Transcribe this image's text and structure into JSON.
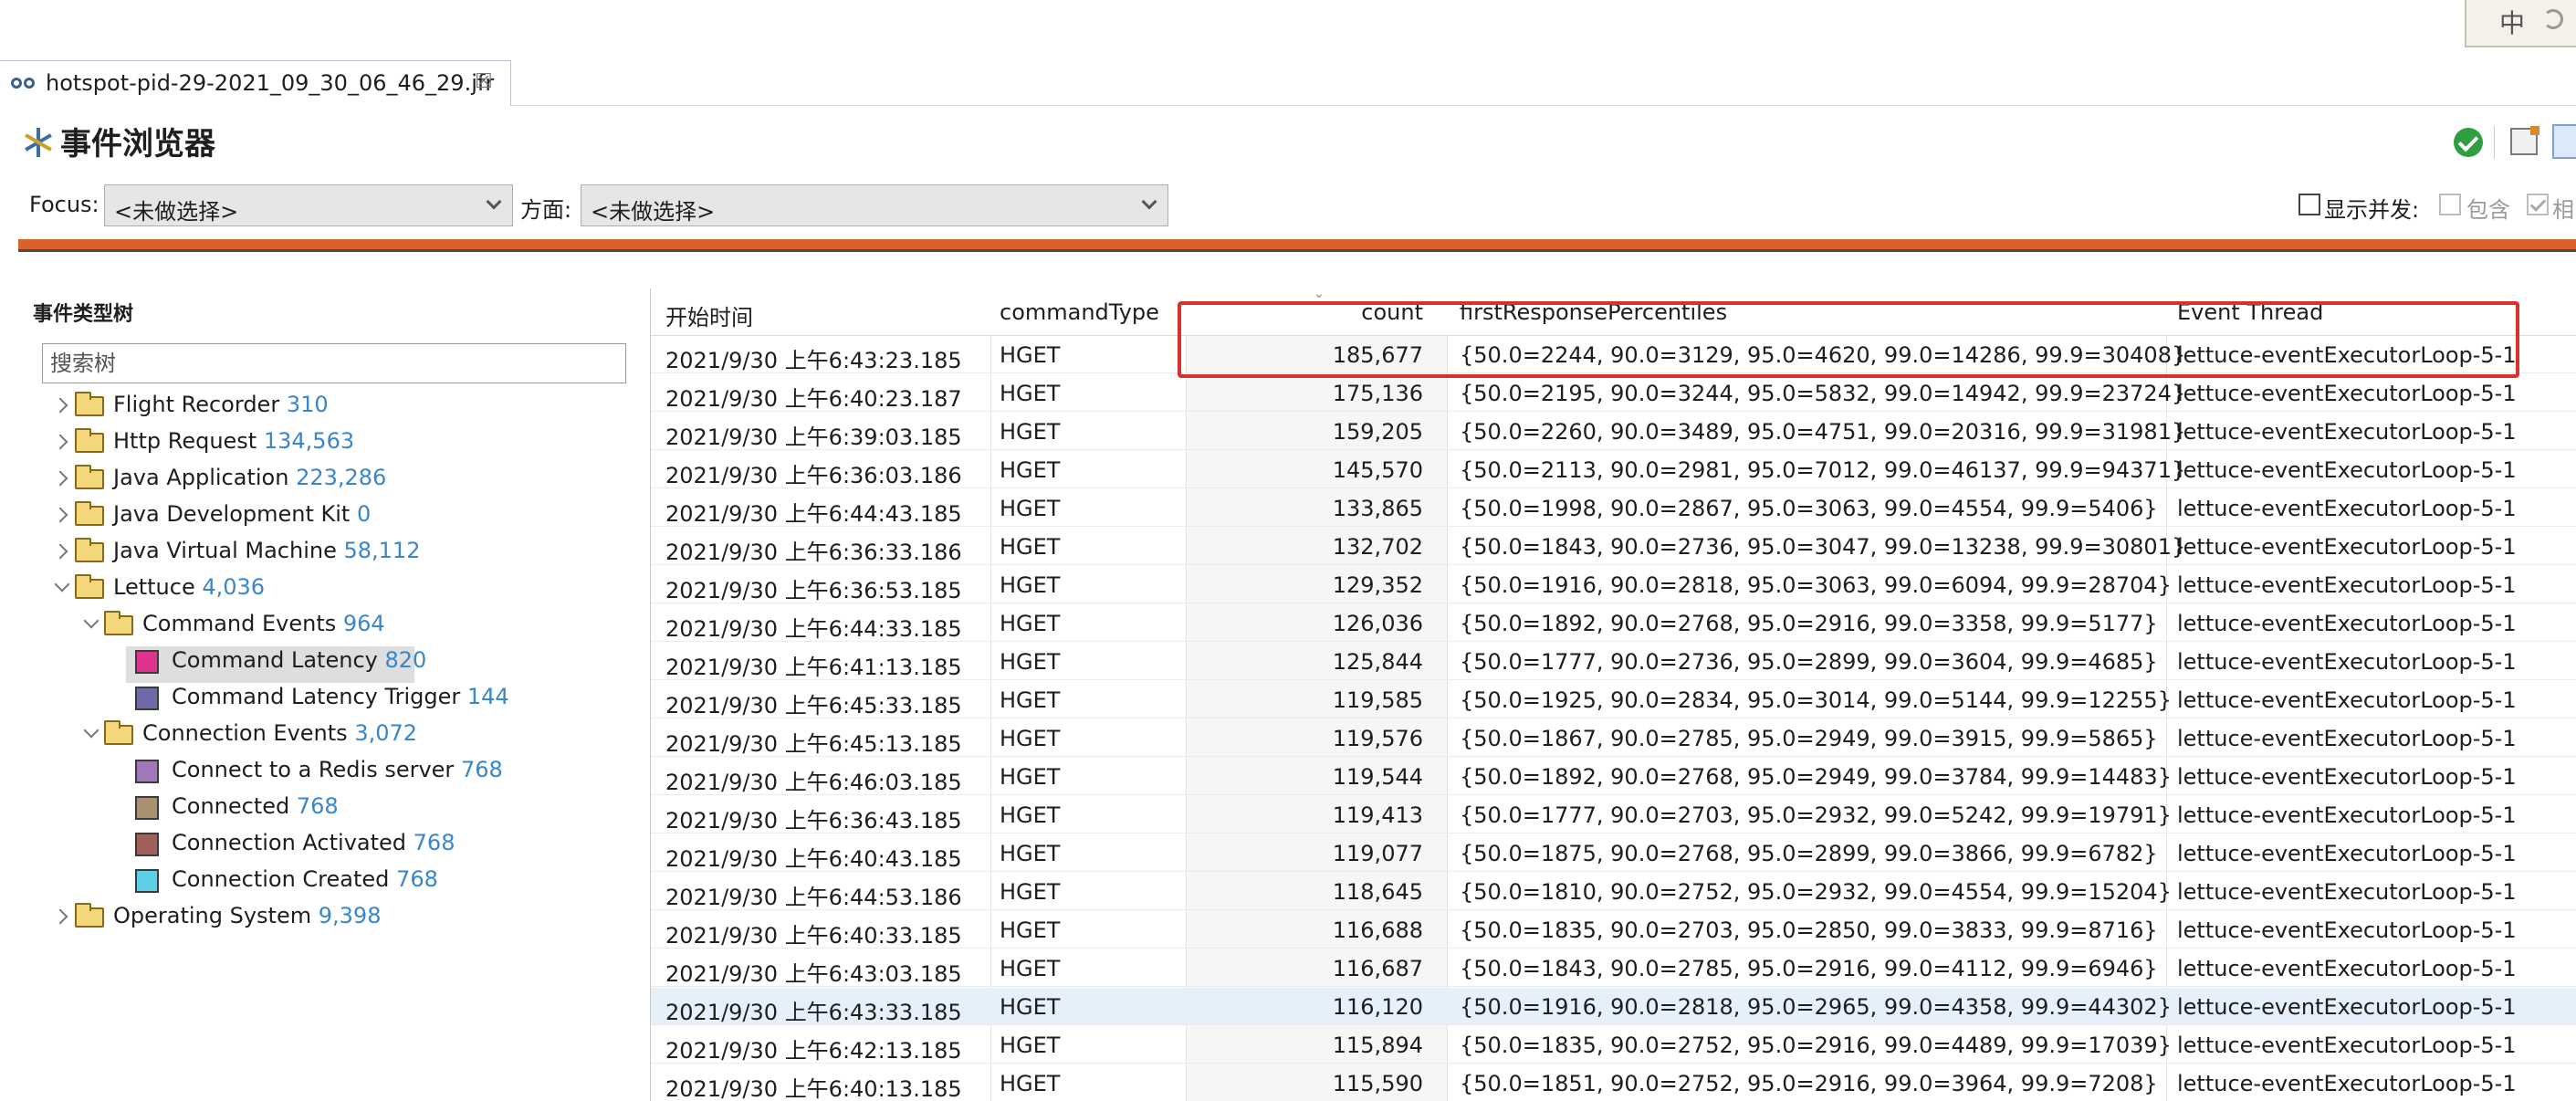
{
  "ime": {
    "char": "中"
  },
  "tab": {
    "title": "hotspot-pid-29-2021_09_30_06_46_29.jfr",
    "close_glyph": "☒"
  },
  "page": {
    "title": "事件浏览器"
  },
  "filter": {
    "focus_label": "Focus:",
    "focus_value": "<未做选择>",
    "aspect_label": "方面:",
    "aspect_value": "<未做选择>",
    "show_concurrent_label": "显示并发:",
    "include_label": "包含",
    "same_label": "相"
  },
  "tree": {
    "header": "事件类型树",
    "search_placeholder": "搜索树",
    "nodes": [
      {
        "label": "Flight Recorder",
        "count": "310"
      },
      {
        "label": "Http Request",
        "count": "134,563"
      },
      {
        "label": "Java Application",
        "count": "223,286"
      },
      {
        "label": "Java Development Kit",
        "count": "0"
      },
      {
        "label": "Java Virtual Machine",
        "count": "58,112"
      },
      {
        "label": "Lettuce",
        "count": "4,036"
      },
      {
        "label": "Command Events",
        "count": "964"
      },
      {
        "label": "Command Latency",
        "count": "820",
        "color": "#e0338f"
      },
      {
        "label": "Command Latency Trigger",
        "count": "144",
        "color": "#6f6aa8"
      },
      {
        "label": "Connection Events",
        "count": "3,072"
      },
      {
        "label": "Connect to a Redis server",
        "count": "768",
        "color": "#a077b8"
      },
      {
        "label": "Connected",
        "count": "768",
        "color": "#a89070"
      },
      {
        "label": "Connection Activated",
        "count": "768",
        "color": "#a0615a"
      },
      {
        "label": "Connection Created",
        "count": "768",
        "color": "#5dd0e6"
      },
      {
        "label": "Operating System",
        "count": "9,398"
      }
    ]
  },
  "table": {
    "columns": [
      "开始时间",
      "commandType",
      "count",
      "firstResponsePercentiles",
      "Event Thread"
    ],
    "rows": [
      [
        "2021/9/30 上午6:43:23.185",
        "HGET",
        "185,677",
        "{50.0=2244, 90.0=3129, 95.0=4620, 99.0=14286, 99.9=30408}",
        "lettuce-eventExecutorLoop-5-1"
      ],
      [
        "2021/9/30 上午6:40:23.187",
        "HGET",
        "175,136",
        "{50.0=2195, 90.0=3244, 95.0=5832, 99.0=14942, 99.9=23724}",
        "lettuce-eventExecutorLoop-5-1"
      ],
      [
        "2021/9/30 上午6:39:03.185",
        "HGET",
        "159,205",
        "{50.0=2260, 90.0=3489, 95.0=4751, 99.0=20316, 99.9=31981}",
        "lettuce-eventExecutorLoop-5-1"
      ],
      [
        "2021/9/30 上午6:36:03.186",
        "HGET",
        "145,570",
        "{50.0=2113, 90.0=2981, 95.0=7012, 99.0=46137, 99.9=94371}",
        "lettuce-eventExecutorLoop-5-1"
      ],
      [
        "2021/9/30 上午6:44:43.185",
        "HGET",
        "133,865",
        "{50.0=1998, 90.0=2867, 95.0=3063, 99.0=4554, 99.9=5406}",
        "lettuce-eventExecutorLoop-5-1"
      ],
      [
        "2021/9/30 上午6:36:33.186",
        "HGET",
        "132,702",
        "{50.0=1843, 90.0=2736, 95.0=3047, 99.0=13238, 99.9=30801}",
        "lettuce-eventExecutorLoop-5-1"
      ],
      [
        "2021/9/30 上午6:36:53.185",
        "HGET",
        "129,352",
        "{50.0=1916, 90.0=2818, 95.0=3063, 99.0=6094, 99.9=28704}",
        "lettuce-eventExecutorLoop-5-1"
      ],
      [
        "2021/9/30 上午6:44:33.185",
        "HGET",
        "126,036",
        "{50.0=1892, 90.0=2768, 95.0=2916, 99.0=3358, 99.9=5177}",
        "lettuce-eventExecutorLoop-5-1"
      ],
      [
        "2021/9/30 上午6:41:13.185",
        "HGET",
        "125,844",
        "{50.0=1777, 90.0=2736, 95.0=2899, 99.0=3604, 99.9=4685}",
        "lettuce-eventExecutorLoop-5-1"
      ],
      [
        "2021/9/30 上午6:45:33.185",
        "HGET",
        "119,585",
        "{50.0=1925, 90.0=2834, 95.0=3014, 99.0=5144, 99.9=12255}",
        "lettuce-eventExecutorLoop-5-1"
      ],
      [
        "2021/9/30 上午6:45:13.185",
        "HGET",
        "119,576",
        "{50.0=1867, 90.0=2785, 95.0=2949, 99.0=3915, 99.9=5865}",
        "lettuce-eventExecutorLoop-5-1"
      ],
      [
        "2021/9/30 上午6:46:03.185",
        "HGET",
        "119,544",
        "{50.0=1892, 90.0=2768, 95.0=2949, 99.0=3784, 99.9=14483}",
        "lettuce-eventExecutorLoop-5-1"
      ],
      [
        "2021/9/30 上午6:36:43.185",
        "HGET",
        "119,413",
        "{50.0=1777, 90.0=2703, 95.0=2932, 99.0=5242, 99.9=19791}",
        "lettuce-eventExecutorLoop-5-1"
      ],
      [
        "2021/9/30 上午6:40:43.185",
        "HGET",
        "119,077",
        "{50.0=1875, 90.0=2768, 95.0=2899, 99.0=3866, 99.9=6782}",
        "lettuce-eventExecutorLoop-5-1"
      ],
      [
        "2021/9/30 上午6:44:53.186",
        "HGET",
        "118,645",
        "{50.0=1810, 90.0=2752, 95.0=2932, 99.0=4554, 99.9=15204}",
        "lettuce-eventExecutorLoop-5-1"
      ],
      [
        "2021/9/30 上午6:40:33.185",
        "HGET",
        "116,688",
        "{50.0=1835, 90.0=2703, 95.0=2850, 99.0=3833, 99.9=8716}",
        "lettuce-eventExecutorLoop-5-1"
      ],
      [
        "2021/9/30 上午6:43:03.185",
        "HGET",
        "116,687",
        "{50.0=1843, 90.0=2785, 95.0=2916, 99.0=4112, 99.9=6946}",
        "lettuce-eventExecutorLoop-5-1"
      ],
      [
        "2021/9/30 上午6:43:33.185",
        "HGET",
        "116,120",
        "{50.0=1916, 90.0=2818, 95.0=2965, 99.0=4358, 99.9=44302}",
        "lettuce-eventExecutorLoop-5-1"
      ],
      [
        "2021/9/30 上午6:42:13.185",
        "HGET",
        "115,894",
        "{50.0=1835, 90.0=2752, 95.0=2916, 99.0=4489, 99.9=17039}",
        "lettuce-eventExecutorLoop-5-1"
      ],
      [
        "2021/9/30 上午6:40:13.185",
        "HGET",
        "115,590",
        "{50.0=1851, 90.0=2752, 95.0=2916, 99.0=3964, 99.9=7208}",
        "lettuce-eventExecutorLoop-5-1"
      ]
    ]
  }
}
